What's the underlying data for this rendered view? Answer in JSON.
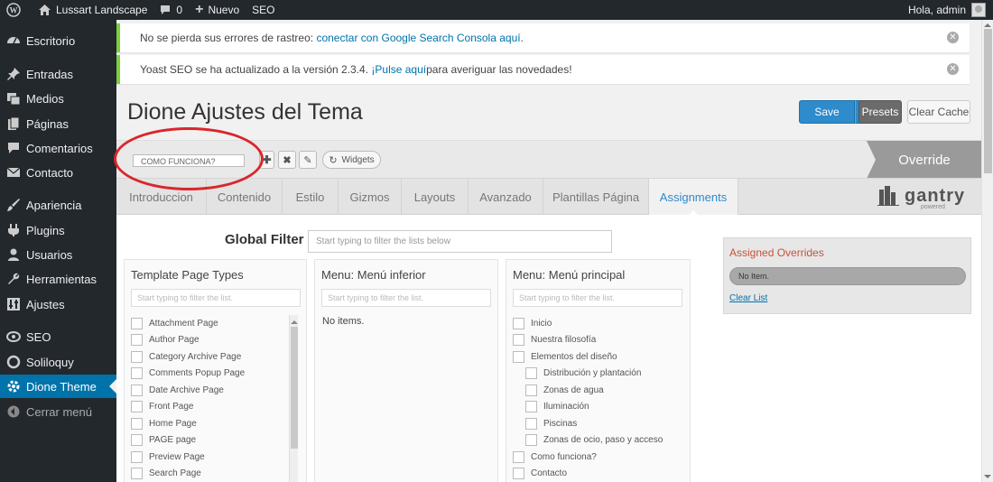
{
  "adminbar": {
    "site": "Lussart Landscape",
    "comments": "0",
    "new_label": "Nuevo",
    "seo": "SEO",
    "greeting": "Hola, admin"
  },
  "sidebar": {
    "items": [
      {
        "label": "Escritorio",
        "icon": "dashboard-icon"
      },
      {
        "label": "Entradas",
        "icon": "pin-icon"
      },
      {
        "label": "Medios",
        "icon": "media-icon"
      },
      {
        "label": "Páginas",
        "icon": "page-icon"
      },
      {
        "label": "Comentarios",
        "icon": "comment-icon"
      },
      {
        "label": "Contacto",
        "icon": "mail-icon"
      },
      {
        "label": "Apariencia",
        "icon": "brush-icon"
      },
      {
        "label": "Plugins",
        "icon": "plugin-icon"
      },
      {
        "label": "Usuarios",
        "icon": "user-icon"
      },
      {
        "label": "Herramientas",
        "icon": "wrench-icon"
      },
      {
        "label": "Ajustes",
        "icon": "settings-icon"
      },
      {
        "label": "SEO",
        "icon": "yoast-icon"
      },
      {
        "label": "Soliloquy",
        "icon": "circle-icon"
      },
      {
        "label": "Dione Theme",
        "icon": "gear-icon"
      },
      {
        "label": "Cerrar menú",
        "icon": "collapse-icon"
      }
    ]
  },
  "notices": {
    "n1_text": "No se pierda sus errores de rastreo: ",
    "n1_link": "conectar con Google Search Consola aquí",
    "n1_end": ".",
    "n2_text": "Yoast SEO se ha actualizado a la versión 2.3.4. ",
    "n2_link": "¡Pulse aquí",
    "n2_end": " para averiguar las novedades!"
  },
  "page": {
    "title": "Dione Ajustes del Tema",
    "save": "Save",
    "presets": "Presets",
    "clear_cache": "Clear Cache",
    "preset_name": "COMO FUNCIONA?",
    "widgets": "Widgets",
    "override": "Override"
  },
  "tabs": [
    "Introduccion",
    "Contenido",
    "Estilo",
    "Gizmos",
    "Layouts",
    "Avanzado",
    "Plantillas Página",
    "Assignments"
  ],
  "brand": {
    "name": "gantry",
    "sub": "powered"
  },
  "filter": {
    "label": "Global Filter",
    "placeholder": "Start typing to filter the lists below",
    "list_placeholder": "Start typing to filter the list."
  },
  "columns": {
    "template": {
      "title": "Template Page Types",
      "items": [
        "Attachment Page",
        "Author Page",
        "Category Archive Page",
        "Comments Popup Page",
        "Date Archive Page",
        "Front Page",
        "Home Page",
        "PAGE page",
        "Preview Page",
        "Search Page"
      ]
    },
    "menu_inferior": {
      "title": "Menu: Menú inferior",
      "empty": "No items."
    },
    "menu_principal": {
      "title": "Menu: Menú principal",
      "items": [
        "Inicio",
        "Nuestra filosofía",
        "Elementos del diseño",
        "Distribución y plantación",
        "Zonas de agua",
        "Iluminación",
        "Piscinas",
        "Zonas de ocio, paso y acceso",
        "Como funciona?",
        "Contacto"
      ]
    }
  },
  "assigned": {
    "title": "Assigned Overrides",
    "empty": "No Item.",
    "clear": "Clear List"
  }
}
